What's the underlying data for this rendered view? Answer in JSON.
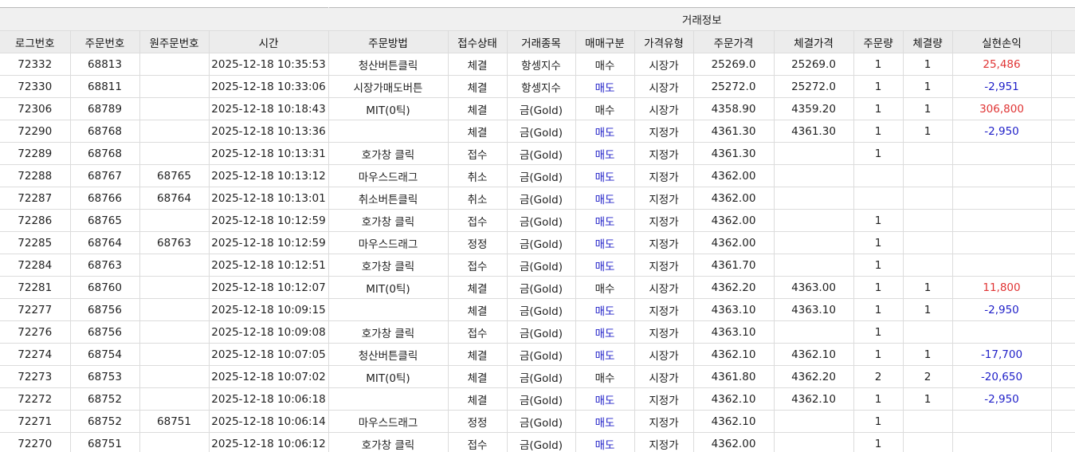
{
  "group_header": "거래정보",
  "columns": [
    "로그번호",
    "주문번호",
    "원주문번호",
    "시간",
    "주문방법",
    "접수상태",
    "거래종목",
    "매매구분",
    "가격유형",
    "주문가격",
    "체결가격",
    "주문량",
    "체결량",
    "실현손익"
  ],
  "colors": {
    "sell": "#1f1fc8",
    "profit_positive": "#e03434",
    "profit_negative": "#1f1fc8",
    "header_bg": "#ececec",
    "grid_line": "#dcdcdc"
  },
  "rows": [
    {
      "log": "72332",
      "order": "68813",
      "orig": "",
      "time": "2025-12-18 10:35:53",
      "method": "청산버튼클릭",
      "status": "체결",
      "item": "항셍지수",
      "side": "매수",
      "ptype": "시장가",
      "oprice": "25269.0",
      "fprice": "25269.0",
      "oqty": "1",
      "fqty": "1",
      "pnl": "25,486",
      "pnl_sign": "pos"
    },
    {
      "log": "72330",
      "order": "68811",
      "orig": "",
      "time": "2025-12-18 10:33:06",
      "method": "시장가매도버튼",
      "status": "체결",
      "item": "항셍지수",
      "side": "매도",
      "ptype": "시장가",
      "oprice": "25272.0",
      "fprice": "25272.0",
      "oqty": "1",
      "fqty": "1",
      "pnl": "-2,951",
      "pnl_sign": "neg"
    },
    {
      "log": "72306",
      "order": "68789",
      "orig": "",
      "time": "2025-12-18 10:18:43",
      "method": "MIT(0틱)",
      "status": "체결",
      "item": "금(Gold)",
      "side": "매수",
      "ptype": "시장가",
      "oprice": "4358.90",
      "fprice": "4359.20",
      "oqty": "1",
      "fqty": "1",
      "pnl": "306,800",
      "pnl_sign": "pos"
    },
    {
      "log": "72290",
      "order": "68768",
      "orig": "",
      "time": "2025-12-18 10:13:36",
      "method": "",
      "status": "체결",
      "item": "금(Gold)",
      "side": "매도",
      "ptype": "지정가",
      "oprice": "4361.30",
      "fprice": "4361.30",
      "oqty": "1",
      "fqty": "1",
      "pnl": "-2,950",
      "pnl_sign": "neg"
    },
    {
      "log": "72289",
      "order": "68768",
      "orig": "",
      "time": "2025-12-18 10:13:31",
      "method": "호가창 클릭",
      "status": "접수",
      "item": "금(Gold)",
      "side": "매도",
      "ptype": "지정가",
      "oprice": "4361.30",
      "fprice": "",
      "oqty": "1",
      "fqty": "",
      "pnl": "",
      "pnl_sign": ""
    },
    {
      "log": "72288",
      "order": "68767",
      "orig": "68765",
      "time": "2025-12-18 10:13:12",
      "method": "마우스드래그",
      "status": "취소",
      "item": "금(Gold)",
      "side": "매도",
      "ptype": "지정가",
      "oprice": "4362.00",
      "fprice": "",
      "oqty": "",
      "fqty": "",
      "pnl": "",
      "pnl_sign": ""
    },
    {
      "log": "72287",
      "order": "68766",
      "orig": "68764",
      "time": "2025-12-18 10:13:01",
      "method": "취소버튼클릭",
      "status": "취소",
      "item": "금(Gold)",
      "side": "매도",
      "ptype": "지정가",
      "oprice": "4362.00",
      "fprice": "",
      "oqty": "",
      "fqty": "",
      "pnl": "",
      "pnl_sign": ""
    },
    {
      "log": "72286",
      "order": "68765",
      "orig": "",
      "time": "2025-12-18 10:12:59",
      "method": "호가창 클릭",
      "status": "접수",
      "item": "금(Gold)",
      "side": "매도",
      "ptype": "지정가",
      "oprice": "4362.00",
      "fprice": "",
      "oqty": "1",
      "fqty": "",
      "pnl": "",
      "pnl_sign": ""
    },
    {
      "log": "72285",
      "order": "68764",
      "orig": "68763",
      "time": "2025-12-18 10:12:59",
      "method": "마우스드래그",
      "status": "정정",
      "item": "금(Gold)",
      "side": "매도",
      "ptype": "지정가",
      "oprice": "4362.00",
      "fprice": "",
      "oqty": "1",
      "fqty": "",
      "pnl": "",
      "pnl_sign": ""
    },
    {
      "log": "72284",
      "order": "68763",
      "orig": "",
      "time": "2025-12-18 10:12:51",
      "method": "호가창 클릭",
      "status": "접수",
      "item": "금(Gold)",
      "side": "매도",
      "ptype": "지정가",
      "oprice": "4361.70",
      "fprice": "",
      "oqty": "1",
      "fqty": "",
      "pnl": "",
      "pnl_sign": ""
    },
    {
      "log": "72281",
      "order": "68760",
      "orig": "",
      "time": "2025-12-18 10:12:07",
      "method": "MIT(0틱)",
      "status": "체결",
      "item": "금(Gold)",
      "side": "매수",
      "ptype": "시장가",
      "oprice": "4362.20",
      "fprice": "4363.00",
      "oqty": "1",
      "fqty": "1",
      "pnl": "11,800",
      "pnl_sign": "pos"
    },
    {
      "log": "72277",
      "order": "68756",
      "orig": "",
      "time": "2025-12-18 10:09:15",
      "method": "",
      "status": "체결",
      "item": "금(Gold)",
      "side": "매도",
      "ptype": "지정가",
      "oprice": "4363.10",
      "fprice": "4363.10",
      "oqty": "1",
      "fqty": "1",
      "pnl": "-2,950",
      "pnl_sign": "neg"
    },
    {
      "log": "72276",
      "order": "68756",
      "orig": "",
      "time": "2025-12-18 10:09:08",
      "method": "호가창 클릭",
      "status": "접수",
      "item": "금(Gold)",
      "side": "매도",
      "ptype": "지정가",
      "oprice": "4363.10",
      "fprice": "",
      "oqty": "1",
      "fqty": "",
      "pnl": "",
      "pnl_sign": ""
    },
    {
      "log": "72274",
      "order": "68754",
      "orig": "",
      "time": "2025-12-18 10:07:05",
      "method": "청산버튼클릭",
      "status": "체결",
      "item": "금(Gold)",
      "side": "매도",
      "ptype": "시장가",
      "oprice": "4362.10",
      "fprice": "4362.10",
      "oqty": "1",
      "fqty": "1",
      "pnl": "-17,700",
      "pnl_sign": "neg"
    },
    {
      "log": "72273",
      "order": "68753",
      "orig": "",
      "time": "2025-12-18 10:07:02",
      "method": "MIT(0틱)",
      "status": "체결",
      "item": "금(Gold)",
      "side": "매수",
      "ptype": "시장가",
      "oprice": "4361.80",
      "fprice": "4362.20",
      "oqty": "2",
      "fqty": "2",
      "pnl": "-20,650",
      "pnl_sign": "neg"
    },
    {
      "log": "72272",
      "order": "68752",
      "orig": "",
      "time": "2025-12-18 10:06:18",
      "method": "",
      "status": "체결",
      "item": "금(Gold)",
      "side": "매도",
      "ptype": "지정가",
      "oprice": "4362.10",
      "fprice": "4362.10",
      "oqty": "1",
      "fqty": "1",
      "pnl": "-2,950",
      "pnl_sign": "neg"
    },
    {
      "log": "72271",
      "order": "68752",
      "orig": "68751",
      "time": "2025-12-18 10:06:14",
      "method": "마우스드래그",
      "status": "정정",
      "item": "금(Gold)",
      "side": "매도",
      "ptype": "지정가",
      "oprice": "4362.10",
      "fprice": "",
      "oqty": "1",
      "fqty": "",
      "pnl": "",
      "pnl_sign": ""
    },
    {
      "log": "72270",
      "order": "68751",
      "orig": "",
      "time": "2025-12-18 10:06:12",
      "method": "호가창 클릭",
      "status": "접수",
      "item": "금(Gold)",
      "side": "매도",
      "ptype": "지정가",
      "oprice": "4362.00",
      "fprice": "",
      "oqty": "1",
      "fqty": "",
      "pnl": "",
      "pnl_sign": ""
    }
  ]
}
